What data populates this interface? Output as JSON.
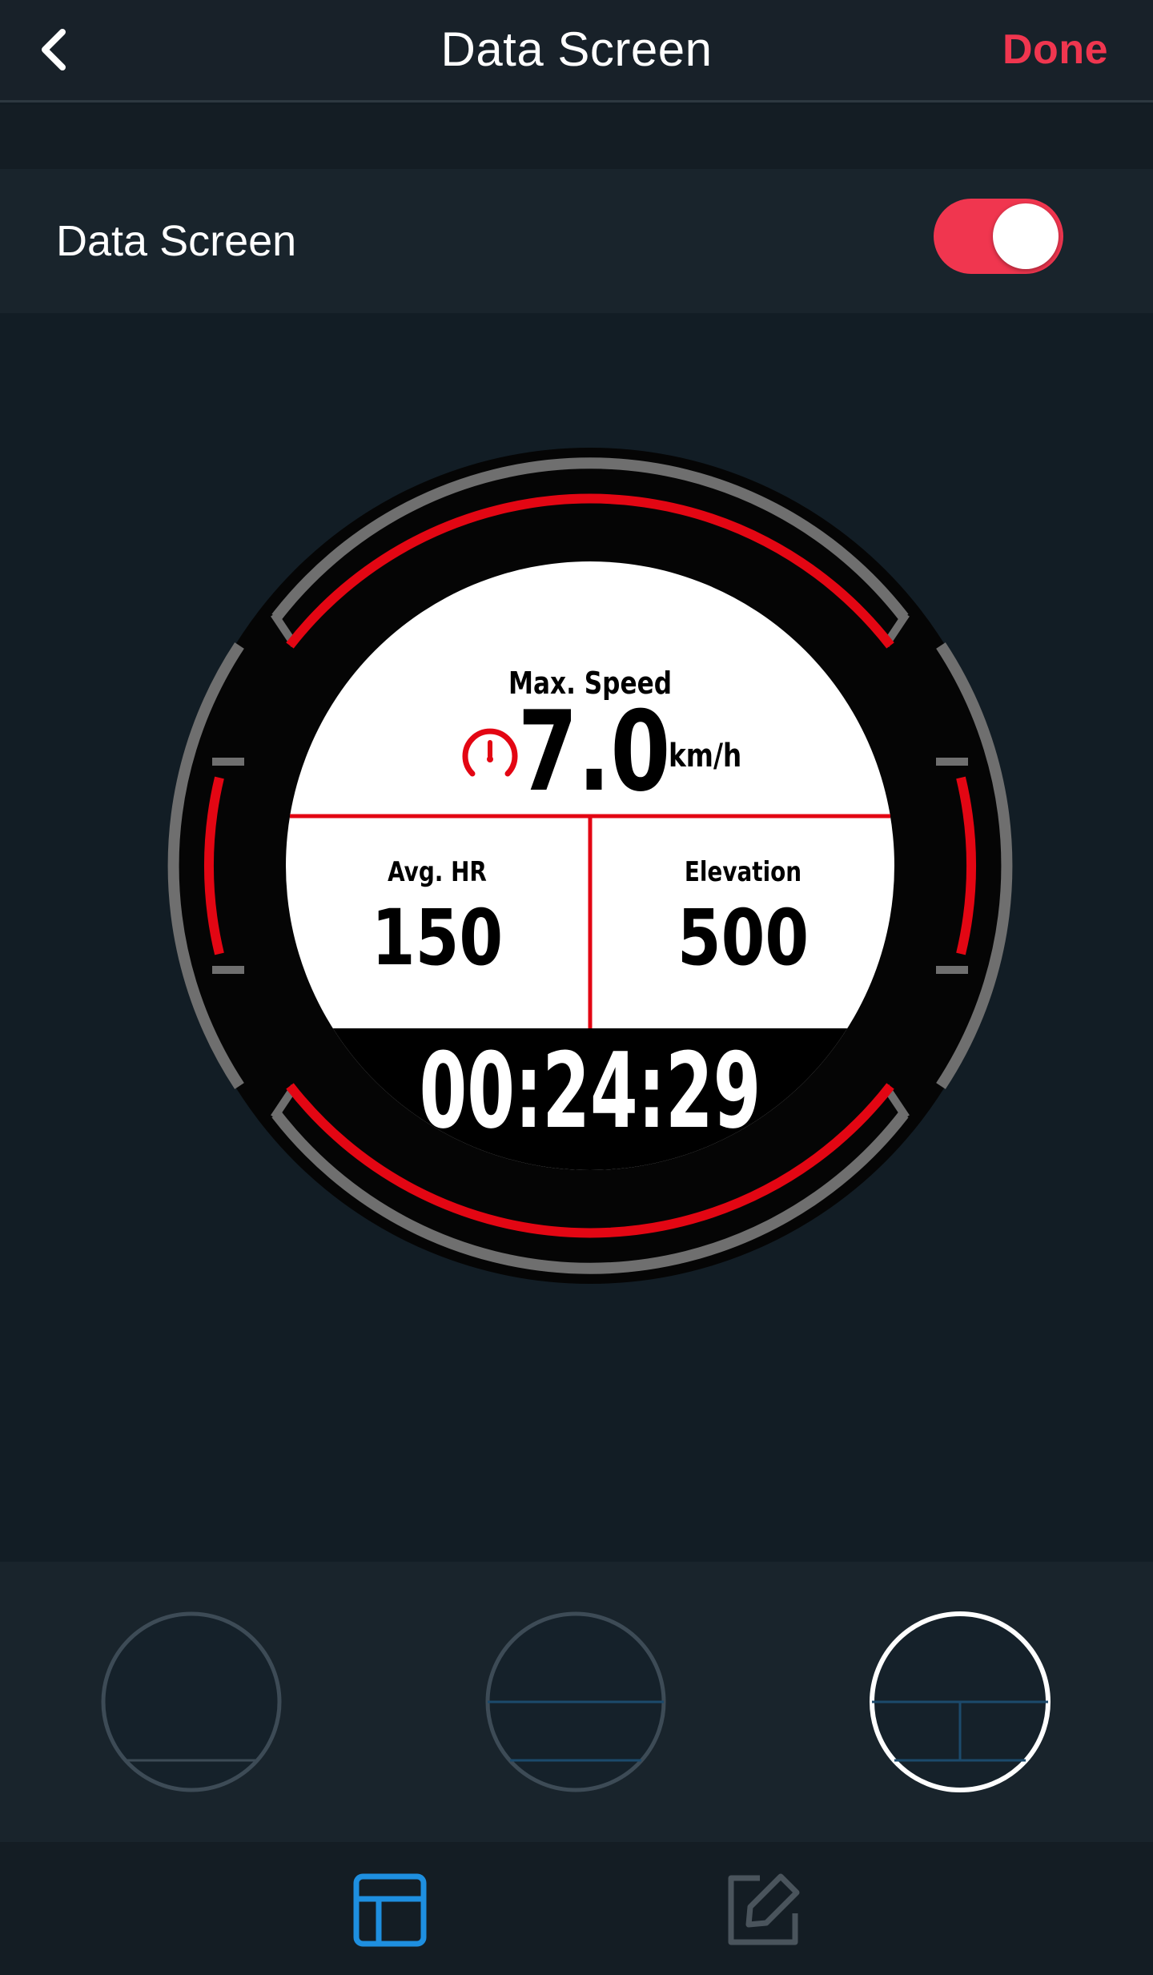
{
  "header": {
    "title": "Data Screen",
    "done_label": "Done"
  },
  "settings": {
    "toggle_label": "Data Screen",
    "toggle_on": true
  },
  "watch": {
    "top_field": {
      "label": "Max. Speed",
      "value": "7.0",
      "unit": "km/h",
      "icon": "speedometer-icon"
    },
    "left_field": {
      "label": "Avg. HR",
      "value": "150"
    },
    "right_field": {
      "label": "Elevation",
      "value": "500"
    },
    "timer": "00:24:29"
  },
  "layouts": {
    "selected_index": 2
  },
  "nav": {
    "items": [
      "layout-icon",
      "edit-icon"
    ],
    "active_index": 0
  },
  "colors": {
    "accent_red": "#f0364f",
    "watch_red": "#e30613",
    "active_blue": "#1e8fe0",
    "background": "#121c23"
  }
}
